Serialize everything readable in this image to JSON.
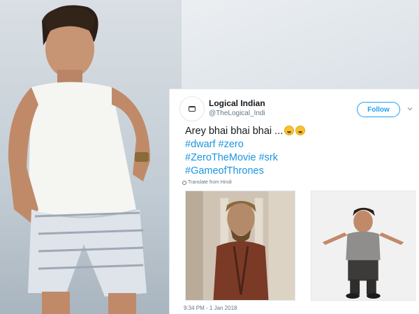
{
  "tweet": {
    "display_name": "Logical Indian",
    "handle": "@TheLogical_Indi",
    "follow_label": "Follow",
    "text": "Arey bhai bhai bhai ...",
    "hashtags_line1": "#dwarf #zero",
    "hashtags_line2": "#ZeroTheMovie #srk",
    "hashtags_line3": "#GameofThrones",
    "translate_label": "Translate from Hindi",
    "timestamp": "9:34 PM - 1 Jan 2018",
    "emoji": "rolling-on-floor-laughing-emoji"
  },
  "colors": {
    "link": "#1b95e0",
    "follow_border": "#1da1f2",
    "text": "#14171a",
    "muted": "#657786"
  }
}
